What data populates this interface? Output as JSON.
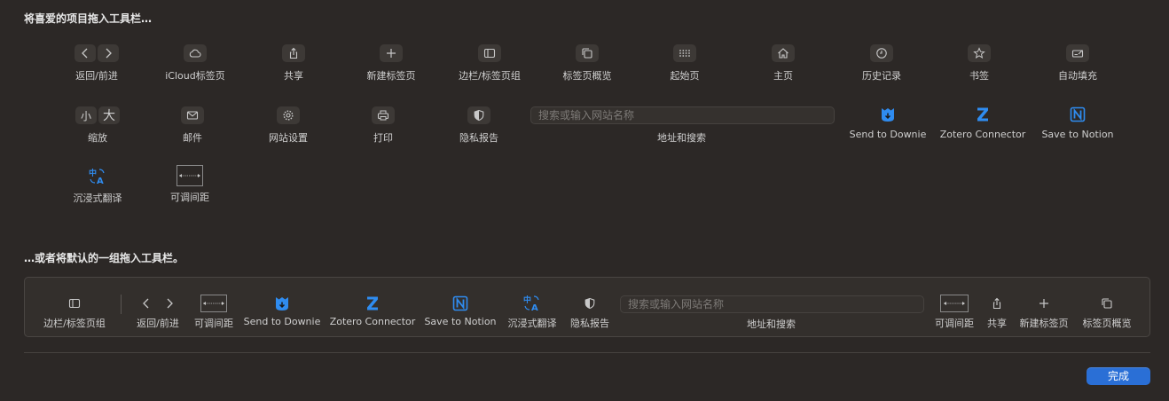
{
  "heading_top": "将喜爱的项目拖入工具栏…",
  "heading_bottom": "…或者将默认的一组拖入工具栏。",
  "items": {
    "back_forward": "返回/前进",
    "icloud_tabs": "iCloud标签页",
    "share": "共享",
    "new_tab": "新建标签页",
    "sidebar_tabgroups": "边栏/标签页组",
    "tab_overview": "标签页概览",
    "start_page": "起始页",
    "home": "主页",
    "history": "历史记录",
    "bookmarks": "书签",
    "autofill": "自动填充",
    "zoom": "缩放",
    "zoom_small": "小",
    "zoom_large": "大",
    "mail": "邮件",
    "website_settings": "网站设置",
    "print": "打印",
    "privacy_report": "隐私报告",
    "address_placeholder": "搜索或输入网站名称",
    "address_search": "地址和搜索",
    "downie": "Send to Downie",
    "zotero": "Zotero Connector",
    "notion": "Save to Notion",
    "immersive_translate": "沉浸式翻译",
    "flexible_space": "可调间距"
  },
  "default_set": {
    "sidebar_tabgroups": "边栏/标签页组",
    "back_forward": "返回/前进",
    "flexible_space": "可调间距",
    "downie": "Send to Downie",
    "zotero": "Zotero Connector",
    "notion": "Save to Notion",
    "immersive_translate": "沉浸式翻译",
    "privacy_report": "隐私报告",
    "address_placeholder": "搜索或输入网站名称",
    "address_search": "地址和搜索",
    "flexible_space_2": "可调间距",
    "share": "共享",
    "new_tab": "新建标签页",
    "tab_overview": "标签页概览"
  },
  "done_label": "完成",
  "colors": {
    "background": "#2c2826",
    "accent": "#2a6fd6",
    "extension_blue": "#2f8cf0"
  }
}
